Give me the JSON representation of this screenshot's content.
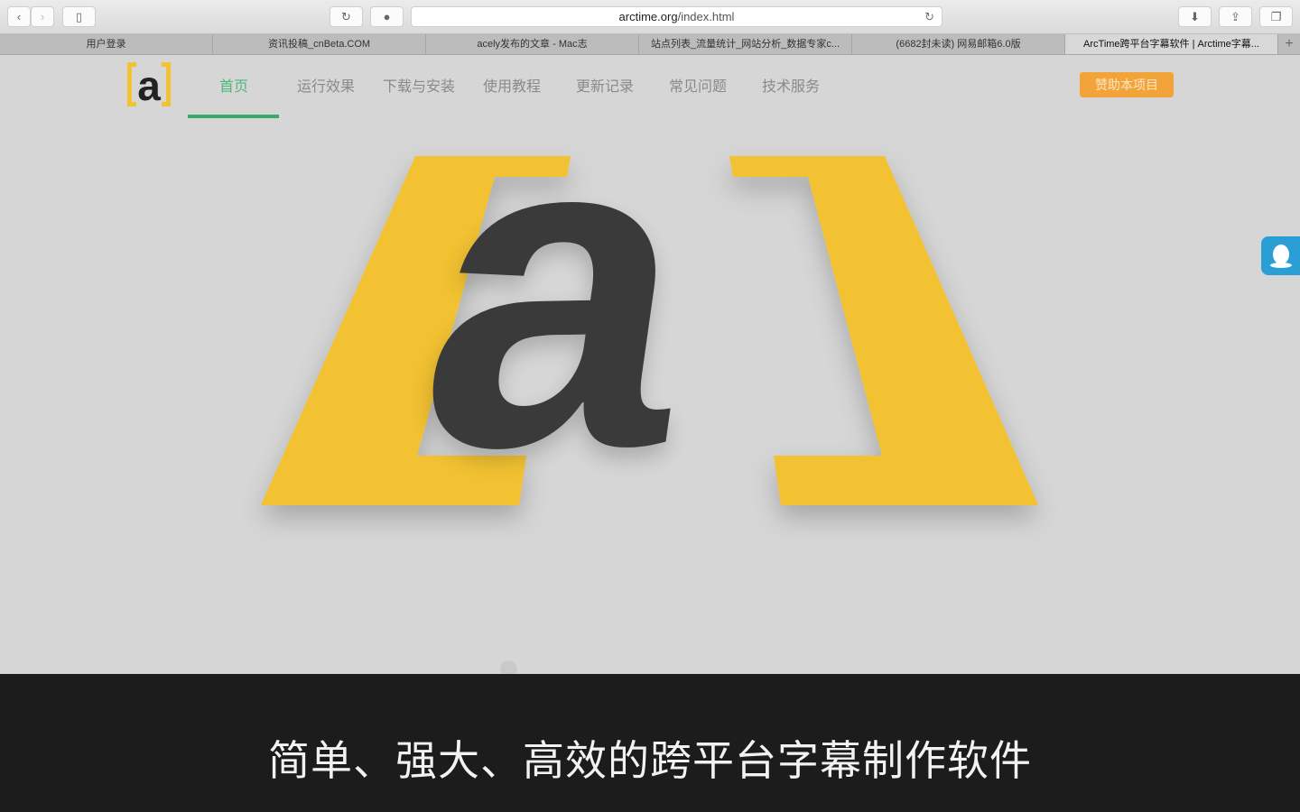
{
  "browser": {
    "url_domain": "arctime.org",
    "url_path": "/index.html",
    "tabs": [
      {
        "label": "用户登录",
        "active": false
      },
      {
        "label": "资讯投稿_cnBeta.COM",
        "active": false
      },
      {
        "label": "acely发布的文章 - Mac志",
        "active": false
      },
      {
        "label": "站点列表_流量统计_网站分析_数据专家c...",
        "active": false
      },
      {
        "label": "(6682封未读) 网易邮箱6.0版",
        "active": false
      },
      {
        "label": "ArcTime跨平台字幕软件 | Arctime字幕...",
        "active": true
      }
    ],
    "new_tab": "+"
  },
  "site": {
    "logo_text": "a",
    "nav": [
      "首页",
      "运行效果",
      "下载与安装",
      "使用教程",
      "更新记录",
      "常见问题",
      "技术服务"
    ],
    "active_nav": 0,
    "donate": "赞助本项目",
    "hero_letter": "a",
    "tagline": "简单、强大、高效的跨平台字幕制作软件",
    "colors": {
      "yellow": "#f2c232",
      "dark": "#3a3a3a",
      "green": "#3aa86a",
      "orange": "#f2a43a",
      "qq": "#2a9fd6"
    }
  }
}
